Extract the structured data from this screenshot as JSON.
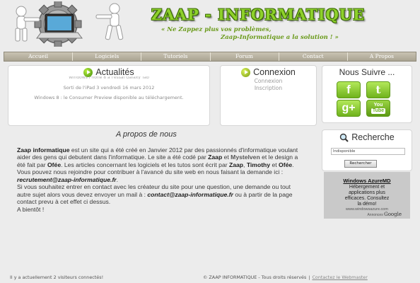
{
  "header": {
    "title": "ZAAP - INFORMATIQUE",
    "slogan_line1": "« Ne Zappez plus vos problèmes,",
    "slogan_line2": "Zaap-Informatique a la solution ! »"
  },
  "nav": {
    "items": [
      {
        "label": "Accueil"
      },
      {
        "label": "Logiciels"
      },
      {
        "label": "Tutoriels"
      },
      {
        "label": "Forum"
      },
      {
        "label": "Contact"
      },
      {
        "label": "A Propos"
      }
    ]
  },
  "news": {
    "title": "Actualités",
    "cut_line": "Windows Phone 8 à l'essai Galaxy Tab",
    "line1": "Sorti de l'iPad 3 vendredi 16 mars 2012",
    "line2": "Windows 8 : le Consumer Preview disponible au téléchargement."
  },
  "login": {
    "title": "Connexion",
    "link1": "Connexion",
    "link2": "Inscription"
  },
  "follow": {
    "title": "Nous Suivre ...",
    "facebook": "f",
    "twitter": "t",
    "google": "g+",
    "youtube_you": "You",
    "youtube_tube": "Tube"
  },
  "about": {
    "title": "A propos de nous",
    "p_zaap": "Zaap informatique",
    "p1": " est un site qui a été créé en Janvier 2012 par des passionnés d'informatique voulant aider des gens qui debutent dans l'informatique. Le site a été codé par ",
    "p_zaap2": "Zaap",
    "p2": " et ",
    "p_myst": "Mystelven",
    "p3": " et le design a été fait par ",
    "p_ofee": "Ofée",
    "p4": ". Les articles concernant les logiciels et les tutos sont écrit par ",
    "p_zaap3": "Zaap",
    "p5": ", ",
    "p_timothy": "Timothy",
    "p6": " et ",
    "p_ofee2": "Ofée",
    "p7": ". Vous pouvez nous rejoindre pour contribuer à l'avancé du site web en nous faisant la demande ici : ",
    "p_recrut": "recrutement@zaap-informatique.fr",
    "p8": ".",
    "p9": "Si vous souhaitez entrer en contact avec les créateur du site pour une question, une demande ou tout autre sujet alors vous devez envoyer un mail à : ",
    "p_contact": "contact@zaap-informatique.fr",
    "p10": " ou à partir de la page contact prevu à cet effet ci dessus.",
    "p11": "A bientôt !"
  },
  "search": {
    "title": "Recherche",
    "value": "Indisponible",
    "button": "Rechercher"
  },
  "ad": {
    "title": "Windows AzureMD",
    "line1": "Hébergement et",
    "line2": "applications plus",
    "line3": "efficaces. Consultez",
    "line4": "la démo!",
    "url": "www.windowsazure.com",
    "footer_label": "Annonces",
    "footer_brand": "Google"
  },
  "footer": {
    "visitors": "Il y a actuellement 2 visiteurs connectés!",
    "copyright": "© ZAAP INFORMATIQUE - Tous droits réservés",
    "separator": "|",
    "contact_link": "Contactez le Webmaster"
  },
  "colors": {
    "accent_green": "#8ed12b",
    "nav_bg": "#b7b19f",
    "page_bg": "#ececec"
  }
}
